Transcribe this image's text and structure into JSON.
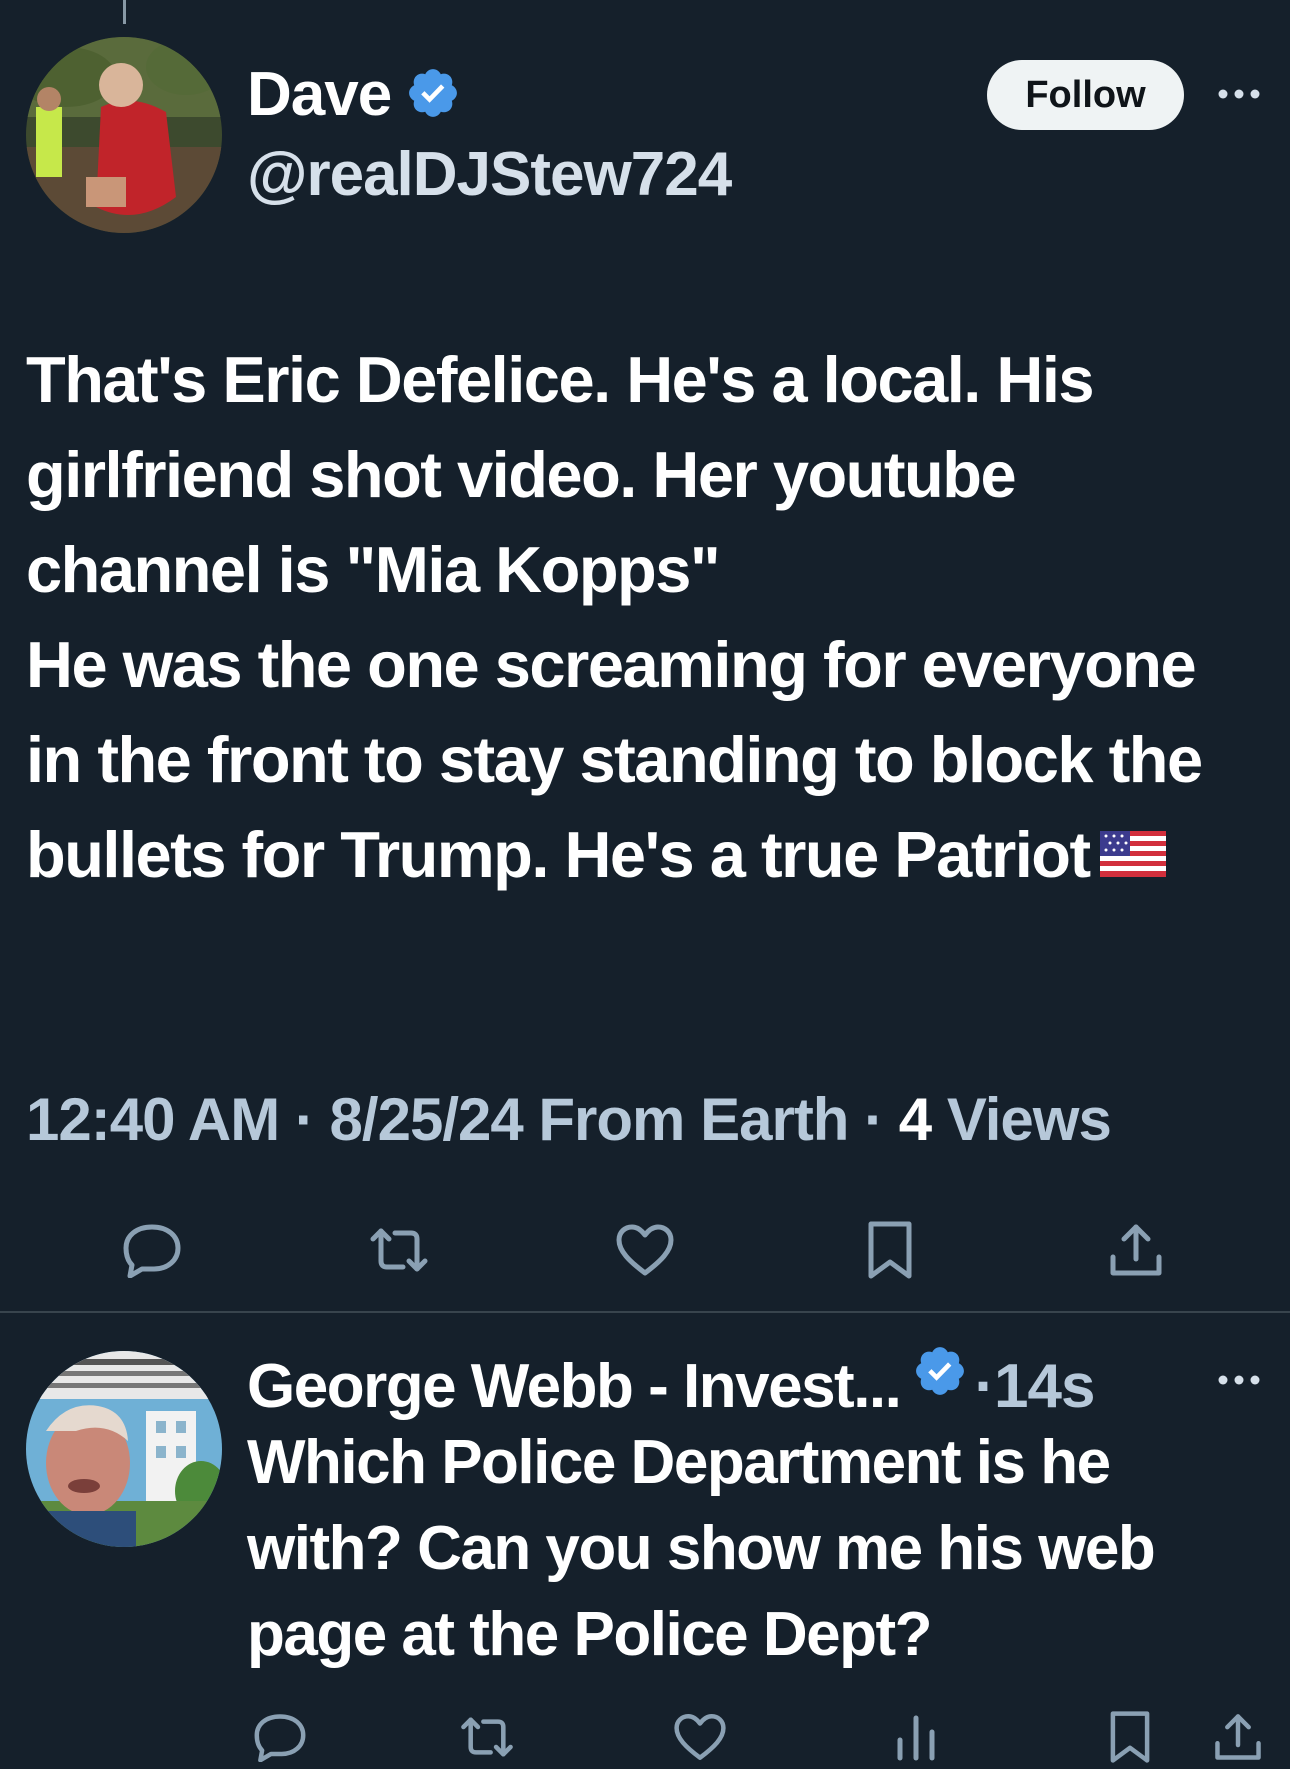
{
  "main_tweet": {
    "display_name": "Dave",
    "handle": "@realDJStew724",
    "follow_label": "Follow",
    "body": "That's Eric Defelice. He's a local. His girlfriend shot video. Her youtube channel is \"Mia Kopps\"\nHe was the one screaming for everyone in the front to stay standing to block the bullets for Trump. He's a true Patriot",
    "flag_emoji": "us-flag",
    "time": "12:40 AM",
    "separator": " · ",
    "date": "8/25/24",
    "source": "From Earth",
    "views_count": "4",
    "views_label": "Views",
    "actions": [
      "reply-icon",
      "retweet-icon",
      "like-icon",
      "bookmark-icon",
      "share-icon"
    ]
  },
  "reply_tweet": {
    "display_name": "George Webb - Invest...",
    "time": "·14s",
    "body": "Which Police Department is he with?  Can you show me his web page at the Police Dept?",
    "actions": [
      "reply-icon",
      "retweet-icon",
      "like-icon",
      "views-icon",
      "bookmark-icon",
      "share-icon"
    ]
  },
  "colors": {
    "background": "#15202b",
    "verified_badge": "#4a99e9",
    "secondary_text": "#b6c8d9",
    "divider": "#38444d"
  }
}
